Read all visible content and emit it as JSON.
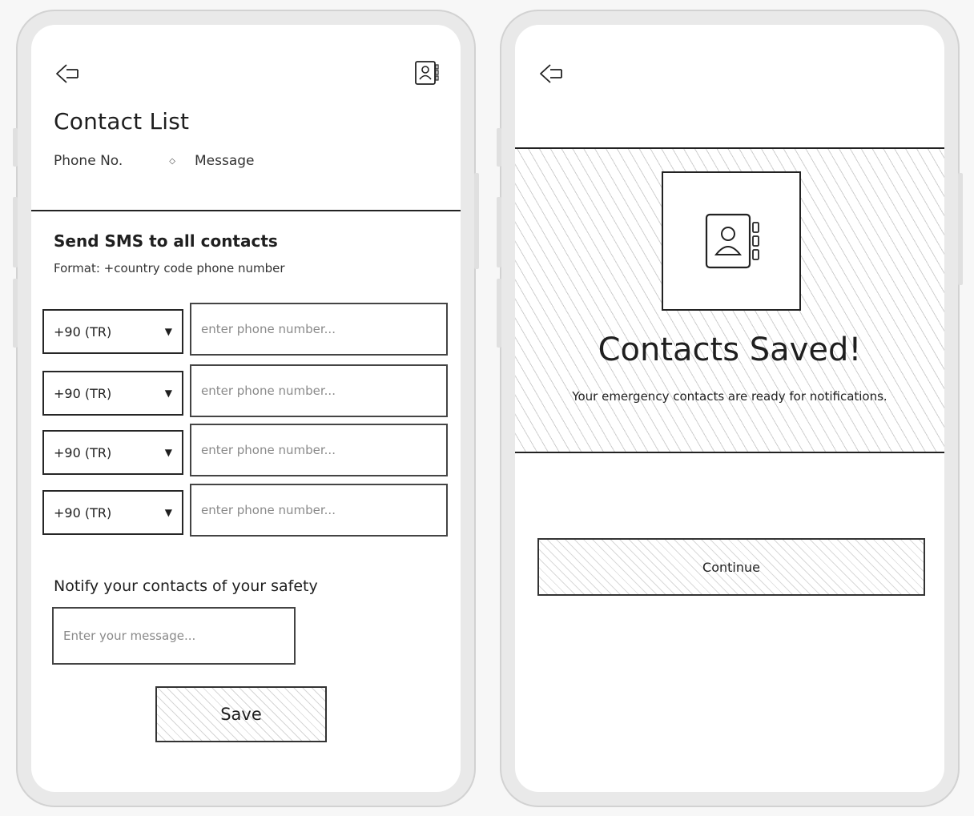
{
  "form_screen": {
    "title": "Contact List",
    "tabs": [
      "Phone No.",
      "Message"
    ],
    "sms_heading": "Send SMS to all contacts",
    "format_hint": "Format: +country code phone number",
    "phone_rows": [
      {
        "country_code": "+90 (TR)",
        "phone_placeholder": "enter phone number..."
      },
      {
        "country_code": "+90 (TR)",
        "phone_placeholder": "enter phone number..."
      },
      {
        "country_code": "+90 (TR)",
        "phone_placeholder": "enter phone number..."
      },
      {
        "country_code": "+90 (TR)",
        "phone_placeholder": "enter phone number..."
      }
    ],
    "notify_heading": "Notify your contacts of your safety",
    "message_placeholder": "Enter your message...",
    "save_label": "Save"
  },
  "success_screen": {
    "title": "Contacts Saved!",
    "subtitle": "Your emergency contacts are ready for notifications.",
    "continue_label": "Continue"
  },
  "icons": {
    "back": "arrow-left-icon",
    "contacts": "address-book-icon",
    "chevron": "chevron-down-icon"
  }
}
